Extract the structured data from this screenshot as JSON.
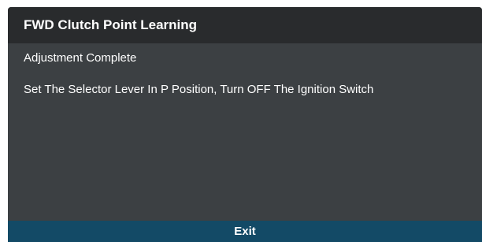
{
  "dialog": {
    "title": "FWD Clutch Point Learning",
    "status_message": "Adjustment Complete",
    "instruction_message": "Set The Selector Lever In P Position, Turn OFF The Ignition Switch",
    "exit_label": "Exit"
  },
  "colors": {
    "title_bar": "#292b2d",
    "body_background": "#3c4043",
    "exit_bar": "#134a66",
    "text": "#ffffff"
  }
}
